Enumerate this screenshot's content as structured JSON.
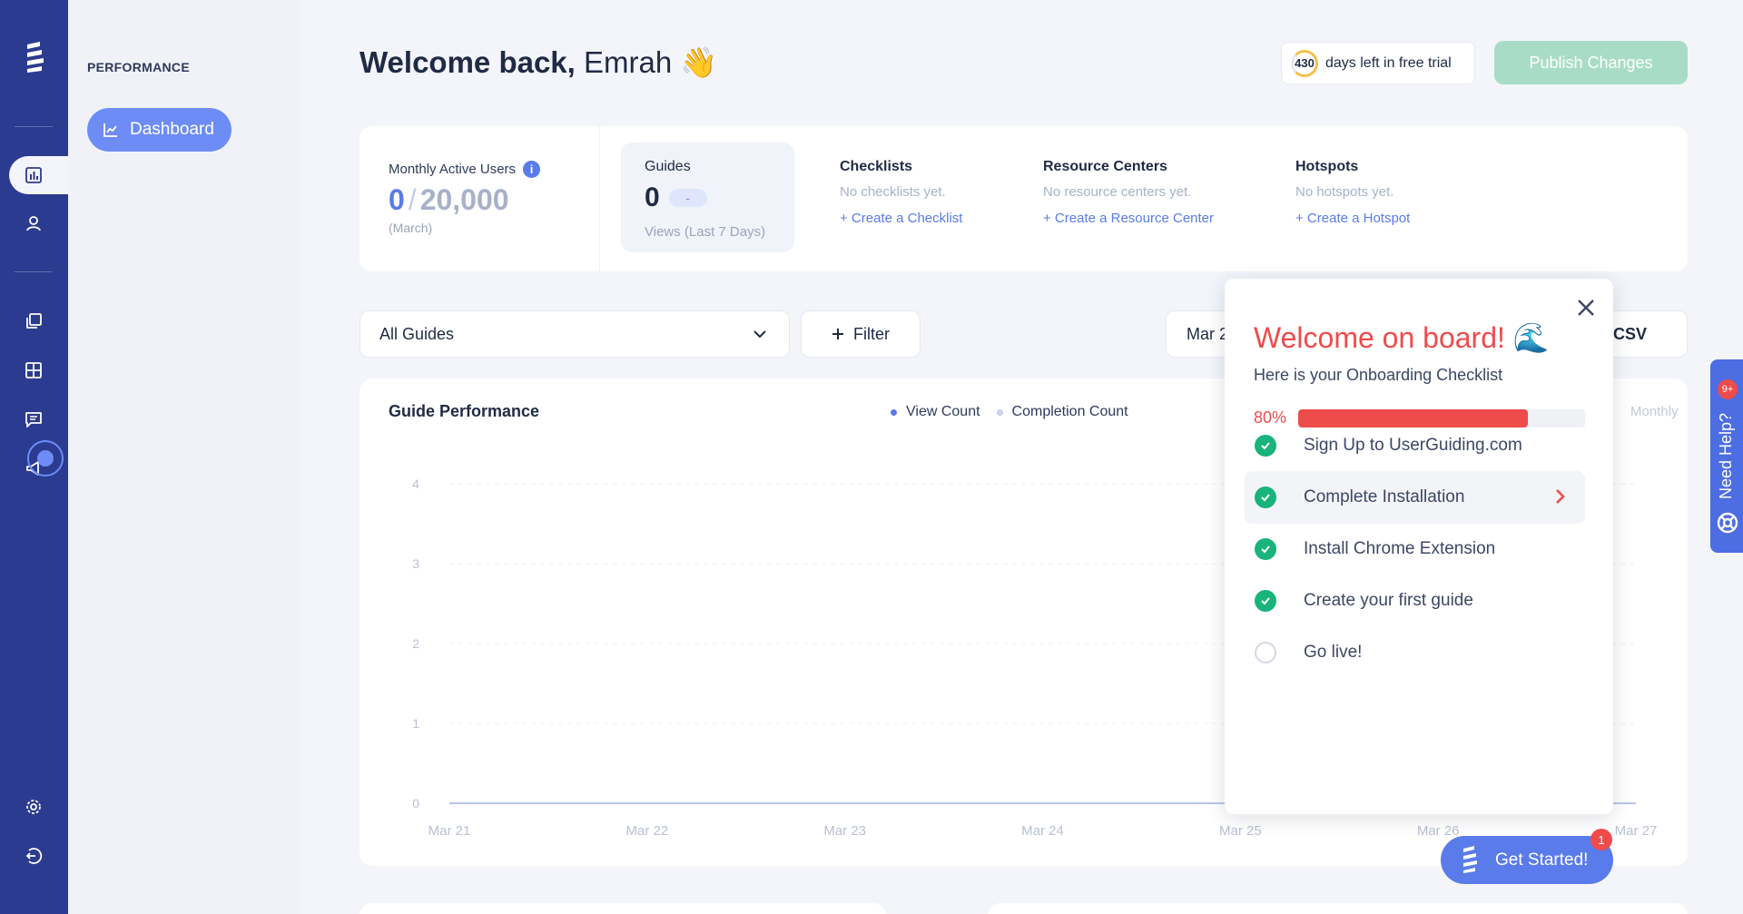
{
  "sidebar": {
    "section": "PERFORMANCE",
    "dashboard_label": "Dashboard"
  },
  "header": {
    "welcome_bold": "Welcome back,",
    "name": "Emrah",
    "wave": "👋",
    "trial_days": "430",
    "trial_text": "days left in free trial",
    "publish_label": "Publish Changes"
  },
  "stats": {
    "mau_label": "Monthly Active Users",
    "mau_value": "0",
    "mau_max": "20,000",
    "mau_period": "(March)",
    "guides_label": "Guides",
    "guides_value": "0",
    "guides_chip": "-",
    "guides_sub": "Views (Last 7 Days)",
    "checklists": {
      "title": "Checklists",
      "empty": "No checklists yet.",
      "action": "+ Create a Checklist"
    },
    "resource_centers": {
      "title": "Resource Centers",
      "empty": "No resource centers yet.",
      "action": "+ Create a Resource Center"
    },
    "hotspots": {
      "title": "Hotspots",
      "empty": "No hotspots yet.",
      "action": "+ Create a Hotspot"
    }
  },
  "filters": {
    "select_value": "All Guides",
    "filter_label": "Filter",
    "date_label": "Mar 2",
    "csv_label": "CSV"
  },
  "chart": {
    "title": "Guide Performance",
    "legend_view": "View Count",
    "legend_completion": "Completion Count",
    "monthly": "Monthly"
  },
  "chart_data": {
    "type": "line",
    "title": "Guide Performance",
    "x": [
      "Mar 21",
      "Mar 22",
      "Mar 23",
      "Mar 24",
      "Mar 25",
      "Mar 26",
      "Mar 27"
    ],
    "y_ticks": [
      0,
      1,
      2,
      3,
      4
    ],
    "ylim": [
      0,
      4
    ],
    "series": [
      {
        "name": "View Count",
        "values": [
          0,
          0,
          0,
          0,
          0,
          0,
          0
        ],
        "color": "#5a7bea"
      },
      {
        "name": "Completion Count",
        "values": [
          0,
          0,
          0,
          0,
          0,
          0,
          0
        ],
        "color": "#c7d3f4"
      }
    ],
    "grid": true,
    "legend": "top-center"
  },
  "onboarding": {
    "title": "Welcome on board! 🌊",
    "subtitle": "Here is your Onboarding Checklist",
    "progress_label": "80%",
    "progress": 0.8,
    "tasks": [
      {
        "label": "Sign Up to UserGuiding.com",
        "done": true
      },
      {
        "label": "Complete Installation",
        "done": true
      },
      {
        "label": "Install Chrome Extension",
        "done": true
      },
      {
        "label": "Create your first guide",
        "done": true
      },
      {
        "label": "Go live!",
        "done": false
      }
    ]
  },
  "get_started": {
    "label": "Get Started!",
    "badge": "1"
  },
  "help": {
    "label": "Need Help?",
    "badge": "9+"
  },
  "colors": {
    "rail": "#2b3b8f",
    "accent": "#6d8cf5",
    "danger": "#ef4b4b",
    "success": "#18b47b"
  }
}
